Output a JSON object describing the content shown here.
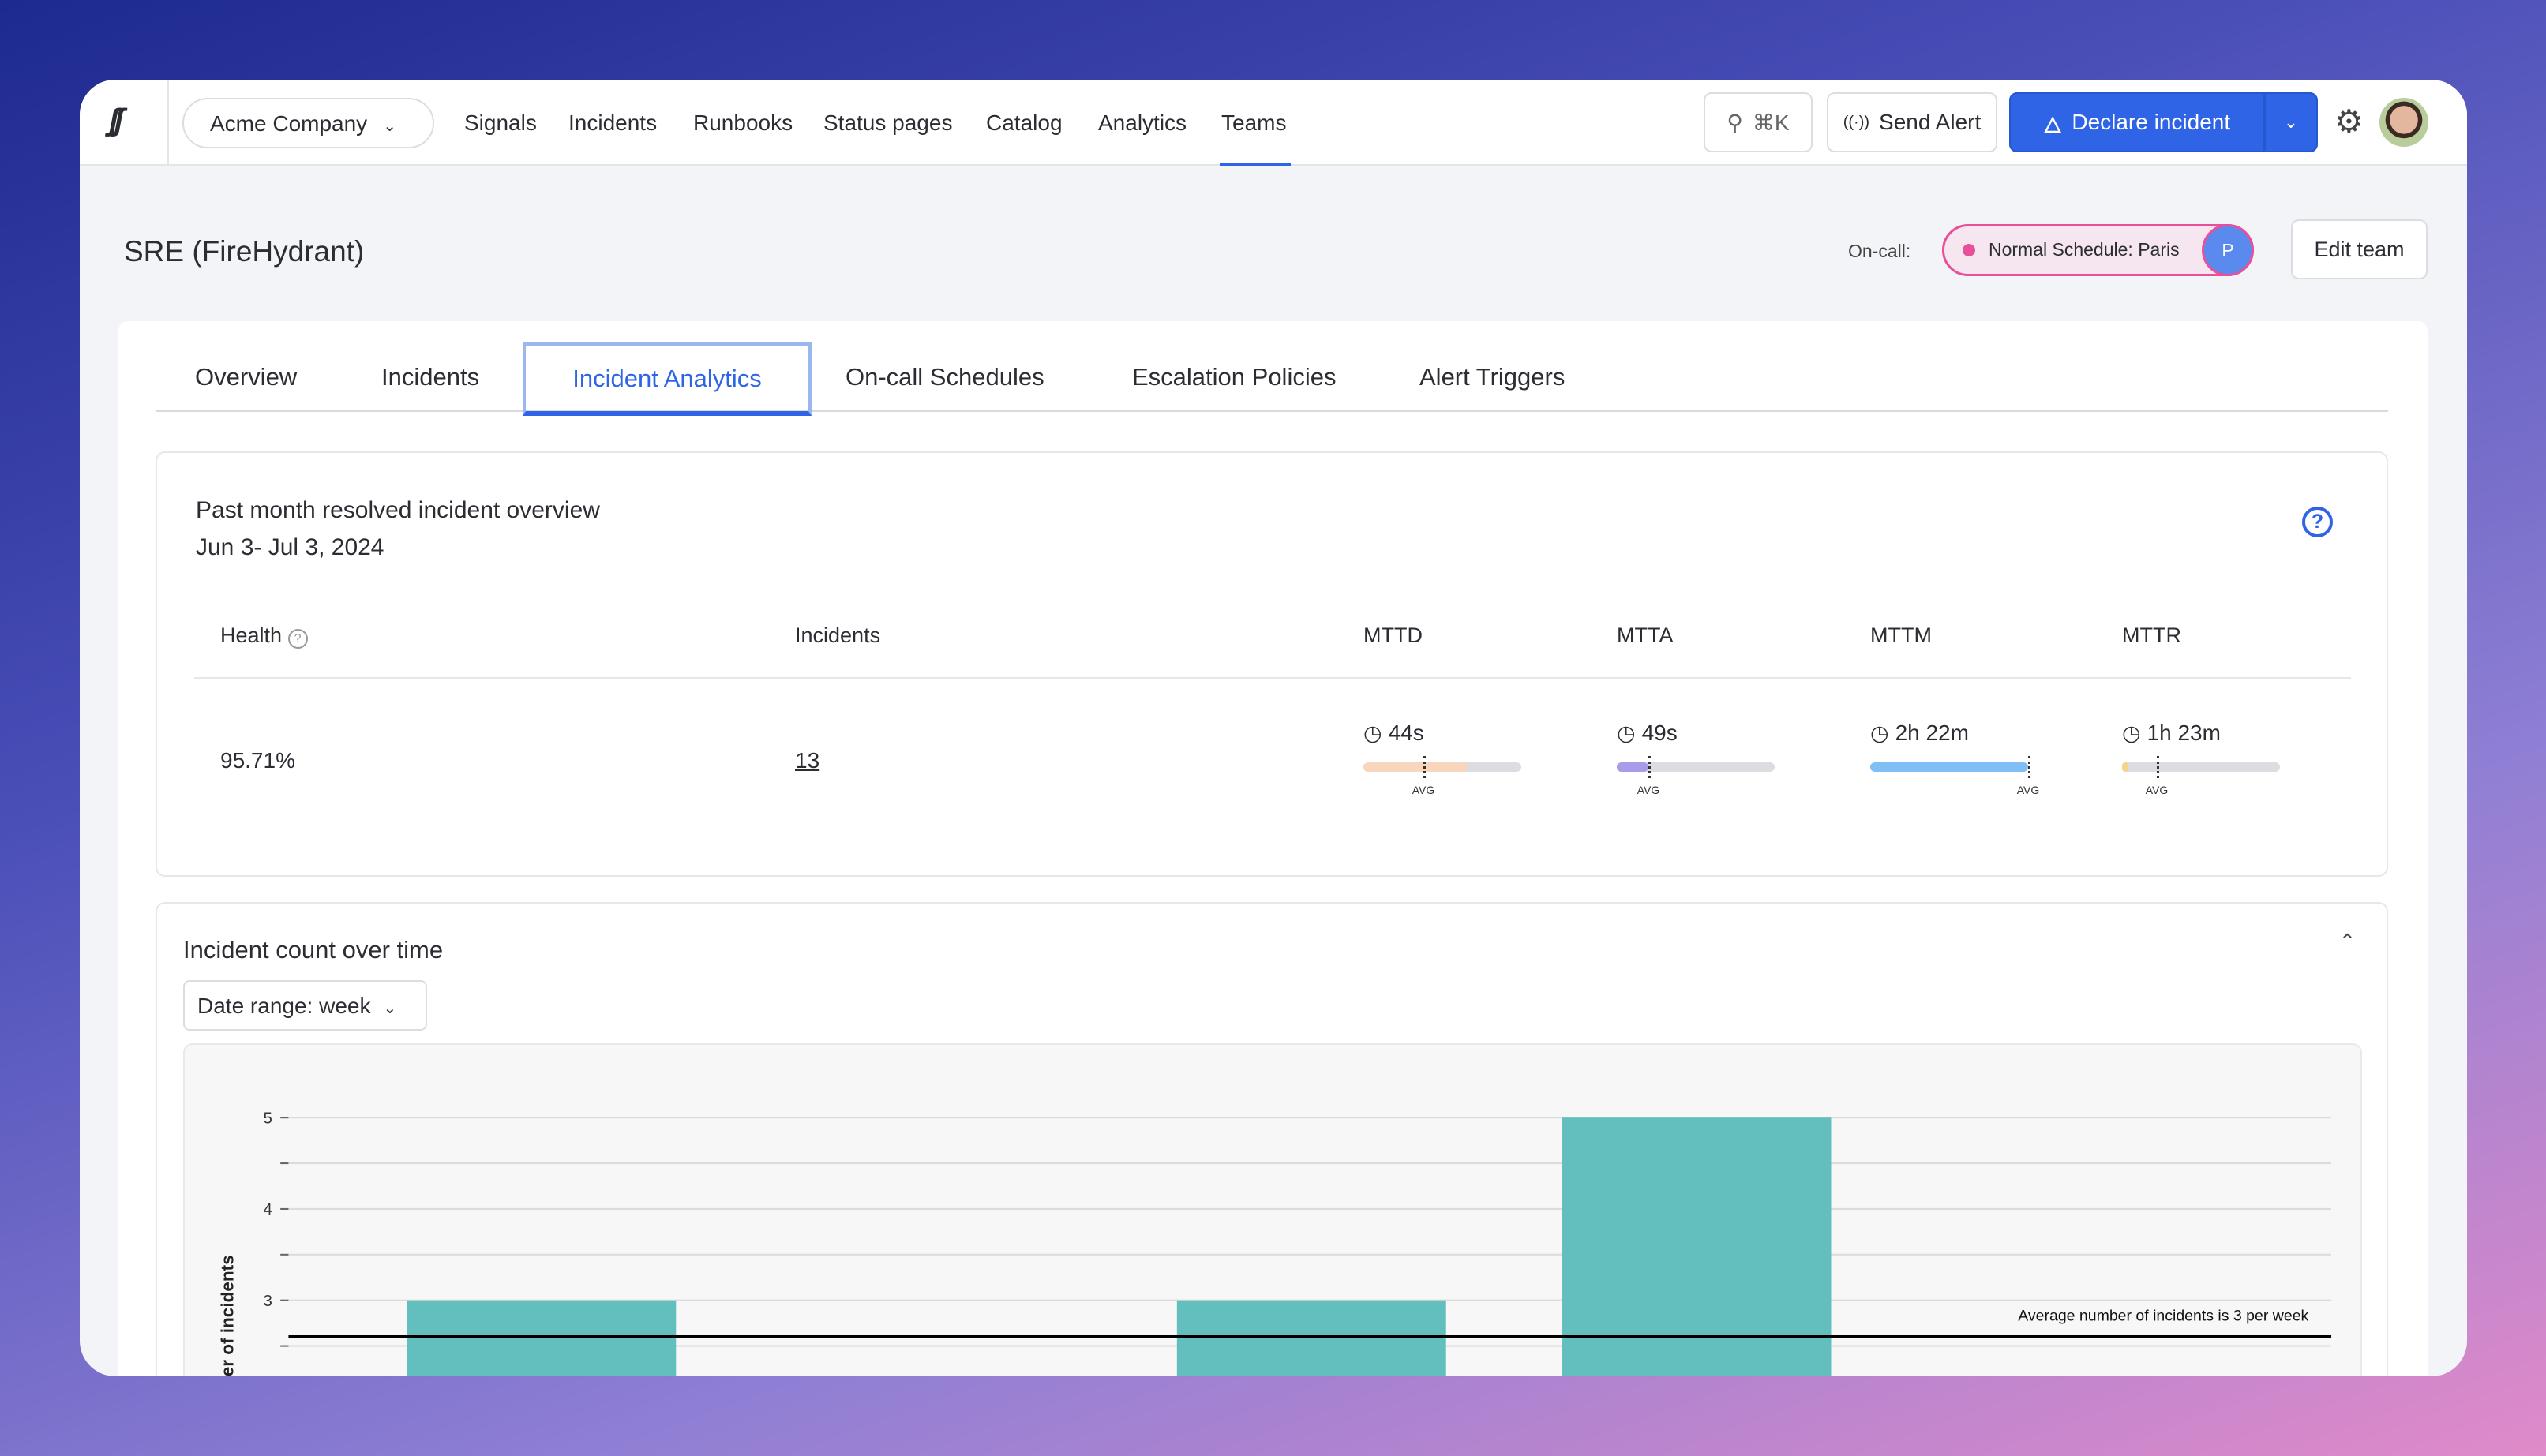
{
  "nav": {
    "company": "Acme Company",
    "items": [
      "Signals",
      "Incidents",
      "Runbooks",
      "Status pages",
      "Catalog",
      "Analytics",
      "Teams"
    ],
    "active": "Teams",
    "search_shortcut": "⌘K",
    "send_alert": "Send Alert",
    "declare_incident": "Declare incident"
  },
  "header": {
    "title": "SRE (FireHydrant)",
    "oncall_label": "On-call:",
    "oncall_schedule": "Normal Schedule: Paris",
    "oncall_avatar": "P",
    "edit_team": "Edit team"
  },
  "tabs": [
    "Overview",
    "Incidents",
    "Incident Analytics",
    "On-call Schedules",
    "Escalation Policies",
    "Alert Triggers"
  ],
  "active_tab": "Incident Analytics",
  "overview": {
    "title": "Past month resolved incident overview",
    "date_range": "Jun 3- Jul 3, 2024",
    "columns": [
      "Health",
      "Incidents",
      "MTTD",
      "MTTA",
      "MTTM",
      "MTTR"
    ],
    "health": "95.71%",
    "incidents": "13",
    "metrics": [
      {
        "name": "MTTD",
        "value": "44s",
        "fill": 0.66,
        "avg": 0.38,
        "color": "#f8d5bd",
        "avg_label": "AVG"
      },
      {
        "name": "MTTA",
        "value": "49s",
        "fill": 0.2,
        "avg": 0.2,
        "color": "#a89be8",
        "avg_label": "AVG"
      },
      {
        "name": "MTTM",
        "value": "2h 22m",
        "fill": 1.0,
        "avg": 1.0,
        "color": "#7fbff5",
        "avg_label": "AVG"
      },
      {
        "name": "MTTR",
        "value": "1h 23m",
        "fill": 0.04,
        "avg": 0.22,
        "color": "#f2d58a",
        "avg_label": "AVG"
      }
    ]
  },
  "incident_chart": {
    "title": "Incident count over time",
    "date_range_select": "Date range: week"
  },
  "chart_data": {
    "type": "bar",
    "ylabel": "Number of incidents",
    "yticks": [
      3,
      4,
      5
    ],
    "ylim_visible": [
      2.2,
      5.3
    ],
    "values": [
      3,
      null,
      3,
      5,
      null
    ],
    "color": "#62bfbd",
    "average": 2.6,
    "average_label": "Average number of incidents is 3 per week",
    "grid": true
  }
}
